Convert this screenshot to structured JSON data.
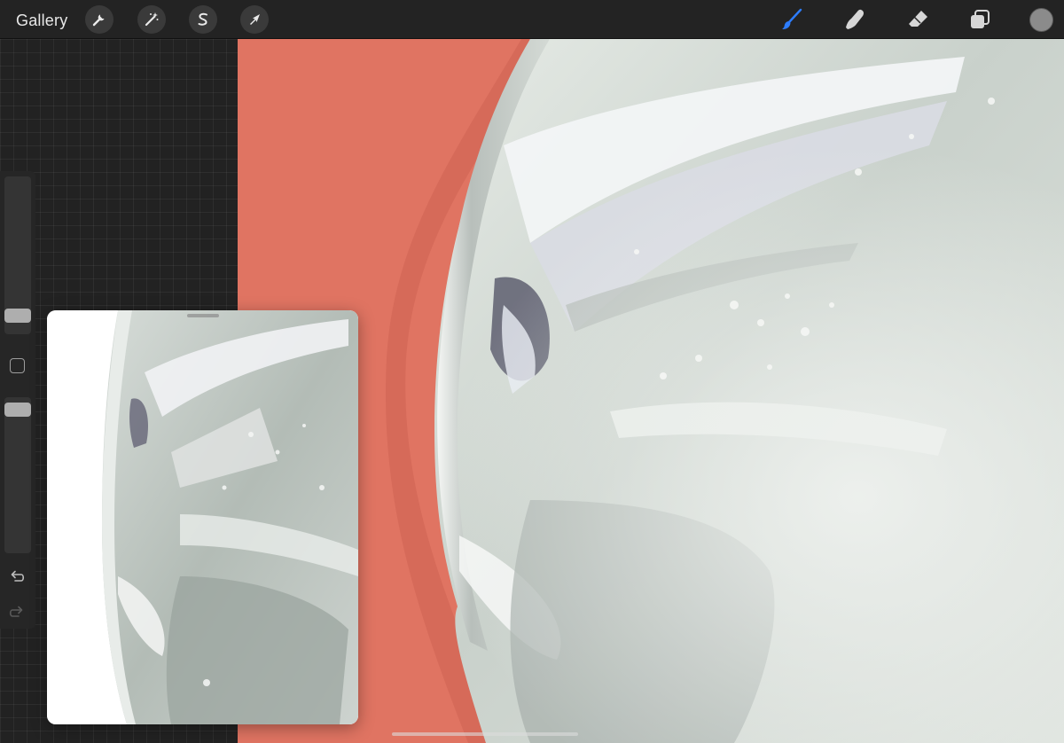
{
  "toolbar": {
    "gallery_label": "Gallery",
    "left_tools": [
      {
        "name": "actions",
        "icon": "wrench-icon"
      },
      {
        "name": "adjustments",
        "icon": "magic-wand-icon"
      },
      {
        "name": "selection",
        "icon": "selection-s-icon"
      },
      {
        "name": "transform",
        "icon": "arrow-cursor-icon"
      }
    ],
    "right_tools": [
      {
        "name": "brush",
        "icon": "brush-icon",
        "active": true
      },
      {
        "name": "smudge",
        "icon": "smudge-finger-icon",
        "active": false
      },
      {
        "name": "eraser",
        "icon": "eraser-icon",
        "active": false
      },
      {
        "name": "layers",
        "icon": "layers-icon",
        "active": false
      }
    ],
    "active_color": "#8b8b8b"
  },
  "sidebar": {
    "brush_size_level": 0.36,
    "opacity_level": 0.08,
    "modify_icon": "square-modify-icon",
    "undo_icon": "undo-arrow-icon",
    "redo_icon": "redo-arrow-icon"
  },
  "colors": {
    "canvas_background": "#e07462",
    "accent_blue": "#2d7dff",
    "toolbar_bg": "#232323"
  }
}
